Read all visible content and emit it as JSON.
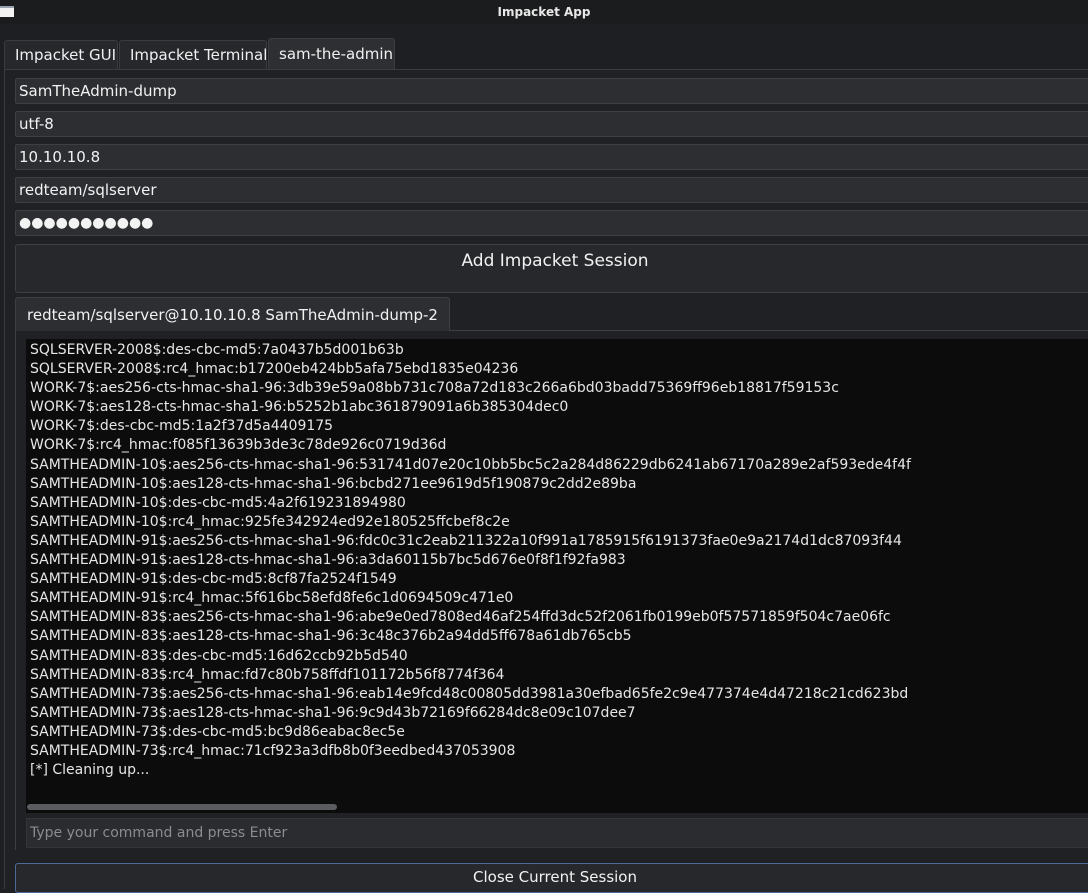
{
  "window": {
    "title": "Impacket App"
  },
  "tabs": [
    {
      "label": "Impacket GUI"
    },
    {
      "label": "Impacket Terminal"
    },
    {
      "label": "sam-the-admin",
      "active": true
    }
  ],
  "form": {
    "session_name": "SamTheAdmin-dump",
    "encoding": "utf-8",
    "target_ip": "10.10.10.8",
    "credentials": "redteam/sqlserver",
    "password_mask": "●●●●●●●●●●●",
    "add_button_label": "Add Impacket Session"
  },
  "session": {
    "tab_label": "redteam/sqlserver@10.10.10.8 SamTheAdmin-dump-2",
    "output_lines": [
      "SQLSERVER-2008$:des-cbc-md5:7a0437b5d001b63b",
      "SQLSERVER-2008$:rc4_hmac:b17200eb424bb5afa75ebd1835e04236",
      "WORK-7$:aes256-cts-hmac-sha1-96:3db39e59a08bb731c708a72d183c266a6bd03badd75369ff96eb18817f59153c",
      "WORK-7$:aes128-cts-hmac-sha1-96:b5252b1abc361879091a6b385304dec0",
      "WORK-7$:des-cbc-md5:1a2f37d5a4409175",
      "WORK-7$:rc4_hmac:f085f13639b3de3c78de926c0719d36d",
      "SAMTHEADMIN-10$:aes256-cts-hmac-sha1-96:531741d07e20c10bb5bc5c2a284d86229db6241ab67170a289e2af593ede4f4f",
      "SAMTHEADMIN-10$:aes128-cts-hmac-sha1-96:bcbd271ee9619d5f190879c2dd2e89ba",
      "SAMTHEADMIN-10$:des-cbc-md5:4a2f619231894980",
      "SAMTHEADMIN-10$:rc4_hmac:925fe342924ed92e180525ffcbef8c2e",
      "SAMTHEADMIN-91$:aes256-cts-hmac-sha1-96:fdc0c31c2eab211322a10f991a1785915f6191373fae0e9a2174d1dc87093f44",
      "SAMTHEADMIN-91$:aes128-cts-hmac-sha1-96:a3da60115b7bc5d676e0f8f1f92fa983",
      "SAMTHEADMIN-91$:des-cbc-md5:8cf87fa2524f1549",
      "SAMTHEADMIN-91$:rc4_hmac:5f616bc58efd8fe6c1d0694509c471e0",
      "SAMTHEADMIN-83$:aes256-cts-hmac-sha1-96:abe9e0ed7808ed46af254ffd3dc52f2061fb0199eb0f57571859f504c7ae06fc",
      "SAMTHEADMIN-83$:aes128-cts-hmac-sha1-96:3c48c376b2a94dd5ff678a61db765cb5",
      "SAMTHEADMIN-83$:des-cbc-md5:16d62ccb92b5d540",
      "SAMTHEADMIN-83$:rc4_hmac:fd7c80b758ffdf101172b56f8774f364",
      "SAMTHEADMIN-73$:aes256-cts-hmac-sha1-96:eab14e9fcd48c00805dd3981a30efbad65fe2c9e477374e4d47218c21cd623bd",
      "SAMTHEADMIN-73$:aes128-cts-hmac-sha1-96:9c9d43b72169f66284dc8e09c107dee7",
      "SAMTHEADMIN-73$:des-cbc-md5:bc9d86eabac8ec5e",
      "SAMTHEADMIN-73$:rc4_hmac:71cf923a3dfb8b0f3eedbed437053908",
      "[*] Cleaning up..."
    ],
    "command_placeholder": "Type your command and press Enter",
    "close_button_label": "Close Current Session"
  }
}
